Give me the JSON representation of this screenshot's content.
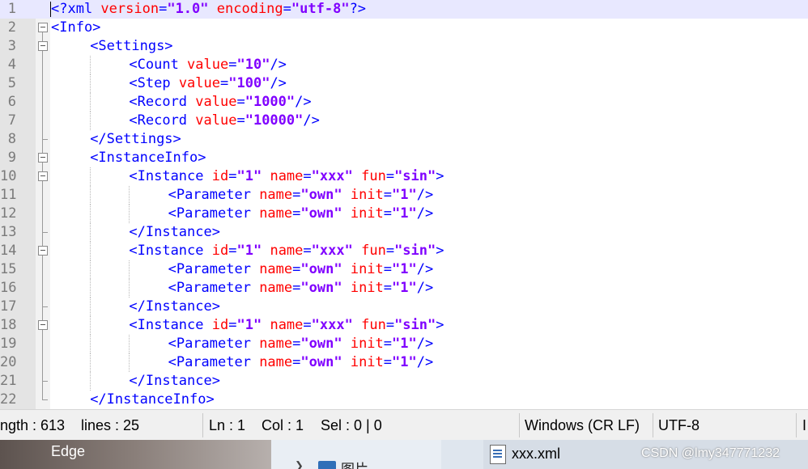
{
  "editor": {
    "lines": [
      {
        "n": "1",
        "indent": 0,
        "fold": "",
        "tokens": [
          [
            "tag",
            "<?xml "
          ],
          [
            "attr",
            "version"
          ],
          [
            "tag",
            "="
          ],
          [
            "val",
            "\"1.0\""
          ],
          [
            "tag",
            " "
          ],
          [
            "attr",
            "encoding"
          ],
          [
            "tag",
            "="
          ],
          [
            "val",
            "\"utf-8\""
          ],
          [
            "tag",
            "?>"
          ]
        ]
      },
      {
        "n": "2",
        "indent": 0,
        "fold": "box",
        "tokens": [
          [
            "tag",
            "<Info>"
          ]
        ]
      },
      {
        "n": "3",
        "indent": 1,
        "fold": "box",
        "tokens": [
          [
            "tag",
            "<Settings>"
          ]
        ]
      },
      {
        "n": "4",
        "indent": 2,
        "fold": "line",
        "tokens": [
          [
            "tag",
            "<Count "
          ],
          [
            "attr",
            "value"
          ],
          [
            "tag",
            "="
          ],
          [
            "val",
            "\"10\""
          ],
          [
            "tag",
            "/>"
          ]
        ]
      },
      {
        "n": "5",
        "indent": 2,
        "fold": "line",
        "tokens": [
          [
            "tag",
            "<Step "
          ],
          [
            "attr",
            "value"
          ],
          [
            "tag",
            "="
          ],
          [
            "val",
            "\"100\""
          ],
          [
            "tag",
            "/>"
          ]
        ]
      },
      {
        "n": "6",
        "indent": 2,
        "fold": "line",
        "tokens": [
          [
            "tag",
            "<Record "
          ],
          [
            "attr",
            "value"
          ],
          [
            "tag",
            "="
          ],
          [
            "val",
            "\"1000\""
          ],
          [
            "tag",
            "/>"
          ]
        ]
      },
      {
        "n": "7",
        "indent": 2,
        "fold": "line",
        "tokens": [
          [
            "tag",
            "<Record "
          ],
          [
            "attr",
            "value"
          ],
          [
            "tag",
            "="
          ],
          [
            "val",
            "\"10000\""
          ],
          [
            "tag",
            "/>"
          ]
        ]
      },
      {
        "n": "8",
        "indent": 1,
        "fold": "end",
        "tokens": [
          [
            "tag",
            "</Settings>"
          ]
        ]
      },
      {
        "n": "9",
        "indent": 1,
        "fold": "box",
        "tokens": [
          [
            "tag",
            "<InstanceInfo>"
          ]
        ]
      },
      {
        "n": "10",
        "indent": 2,
        "fold": "box",
        "tokens": [
          [
            "tag",
            "<Instance "
          ],
          [
            "attr",
            "id"
          ],
          [
            "tag",
            "="
          ],
          [
            "val",
            "\"1\""
          ],
          [
            "tag",
            " "
          ],
          [
            "attr",
            "name"
          ],
          [
            "tag",
            "="
          ],
          [
            "val",
            "\"xxx\""
          ],
          [
            "tag",
            " "
          ],
          [
            "attr",
            "fun"
          ],
          [
            "tag",
            "="
          ],
          [
            "val",
            "\"sin\""
          ],
          [
            "tag",
            ">"
          ]
        ]
      },
      {
        "n": "11",
        "indent": 3,
        "fold": "line",
        "tokens": [
          [
            "tag",
            "<Parameter "
          ],
          [
            "attr",
            "name"
          ],
          [
            "tag",
            "="
          ],
          [
            "val",
            "\"own\""
          ],
          [
            "tag",
            " "
          ],
          [
            "attr",
            "init"
          ],
          [
            "tag",
            "="
          ],
          [
            "val",
            "\"1\""
          ],
          [
            "tag",
            "/>"
          ]
        ]
      },
      {
        "n": "12",
        "indent": 3,
        "fold": "line",
        "tokens": [
          [
            "tag",
            "<Parameter "
          ],
          [
            "attr",
            "name"
          ],
          [
            "tag",
            "="
          ],
          [
            "val",
            "\"own\""
          ],
          [
            "tag",
            " "
          ],
          [
            "attr",
            "init"
          ],
          [
            "tag",
            "="
          ],
          [
            "val",
            "\"1\""
          ],
          [
            "tag",
            "/>"
          ]
        ]
      },
      {
        "n": "13",
        "indent": 2,
        "fold": "end",
        "tokens": [
          [
            "tag",
            "</Instance>"
          ]
        ]
      },
      {
        "n": "14",
        "indent": 2,
        "fold": "box",
        "tokens": [
          [
            "tag",
            "<Instance "
          ],
          [
            "attr",
            "id"
          ],
          [
            "tag",
            "="
          ],
          [
            "val",
            "\"1\""
          ],
          [
            "tag",
            " "
          ],
          [
            "attr",
            "name"
          ],
          [
            "tag",
            "="
          ],
          [
            "val",
            "\"xxx\""
          ],
          [
            "tag",
            " "
          ],
          [
            "attr",
            "fun"
          ],
          [
            "tag",
            "="
          ],
          [
            "val",
            "\"sin\""
          ],
          [
            "tag",
            ">"
          ]
        ]
      },
      {
        "n": "15",
        "indent": 3,
        "fold": "line",
        "tokens": [
          [
            "tag",
            "<Parameter "
          ],
          [
            "attr",
            "name"
          ],
          [
            "tag",
            "="
          ],
          [
            "val",
            "\"own\""
          ],
          [
            "tag",
            " "
          ],
          [
            "attr",
            "init"
          ],
          [
            "tag",
            "="
          ],
          [
            "val",
            "\"1\""
          ],
          [
            "tag",
            "/>"
          ]
        ]
      },
      {
        "n": "16",
        "indent": 3,
        "fold": "line",
        "tokens": [
          [
            "tag",
            "<Parameter "
          ],
          [
            "attr",
            "name"
          ],
          [
            "tag",
            "="
          ],
          [
            "val",
            "\"own\""
          ],
          [
            "tag",
            " "
          ],
          [
            "attr",
            "init"
          ],
          [
            "tag",
            "="
          ],
          [
            "val",
            "\"1\""
          ],
          [
            "tag",
            "/>"
          ]
        ]
      },
      {
        "n": "17",
        "indent": 2,
        "fold": "end",
        "tokens": [
          [
            "tag",
            "</Instance>"
          ]
        ]
      },
      {
        "n": "18",
        "indent": 2,
        "fold": "box",
        "tokens": [
          [
            "tag",
            "<Instance "
          ],
          [
            "attr",
            "id"
          ],
          [
            "tag",
            "="
          ],
          [
            "val",
            "\"1\""
          ],
          [
            "tag",
            " "
          ],
          [
            "attr",
            "name"
          ],
          [
            "tag",
            "="
          ],
          [
            "val",
            "\"xxx\""
          ],
          [
            "tag",
            " "
          ],
          [
            "attr",
            "fun"
          ],
          [
            "tag",
            "="
          ],
          [
            "val",
            "\"sin\""
          ],
          [
            "tag",
            ">"
          ]
        ]
      },
      {
        "n": "19",
        "indent": 3,
        "fold": "line",
        "tokens": [
          [
            "tag",
            "<Parameter "
          ],
          [
            "attr",
            "name"
          ],
          [
            "tag",
            "="
          ],
          [
            "val",
            "\"own\""
          ],
          [
            "tag",
            " "
          ],
          [
            "attr",
            "init"
          ],
          [
            "tag",
            "="
          ],
          [
            "val",
            "\"1\""
          ],
          [
            "tag",
            "/>"
          ]
        ]
      },
      {
        "n": "20",
        "indent": 3,
        "fold": "line",
        "tokens": [
          [
            "tag",
            "<Parameter "
          ],
          [
            "attr",
            "name"
          ],
          [
            "tag",
            "="
          ],
          [
            "val",
            "\"own\""
          ],
          [
            "tag",
            " "
          ],
          [
            "attr",
            "init"
          ],
          [
            "tag",
            "="
          ],
          [
            "val",
            "\"1\""
          ],
          [
            "tag",
            "/>"
          ]
        ]
      },
      {
        "n": "21",
        "indent": 2,
        "fold": "end",
        "tokens": [
          [
            "tag",
            "</Instance>"
          ]
        ]
      },
      {
        "n": "22",
        "indent": 1,
        "fold": "end",
        "tokens": [
          [
            "tag",
            "</InstanceInfo>"
          ]
        ]
      }
    ]
  },
  "status": {
    "length": "ngth : 613",
    "lines": "lines : 25",
    "ln": "Ln : 1",
    "col": "Col : 1",
    "sel": "Sel : 0 | 0",
    "eol": "Windows (CR LF)",
    "encoding": "UTF-8",
    "mode": "I"
  },
  "taskbar": {
    "edge_label": "Edge",
    "folder_label": "图片",
    "file_label": "xxx.xml",
    "watermark": "CSDN @lmy347771232"
  },
  "colors": {
    "tag": "#0000ff",
    "attribute": "#ff0000",
    "value": "#8000ff",
    "current_line": "#e8e8ff"
  }
}
